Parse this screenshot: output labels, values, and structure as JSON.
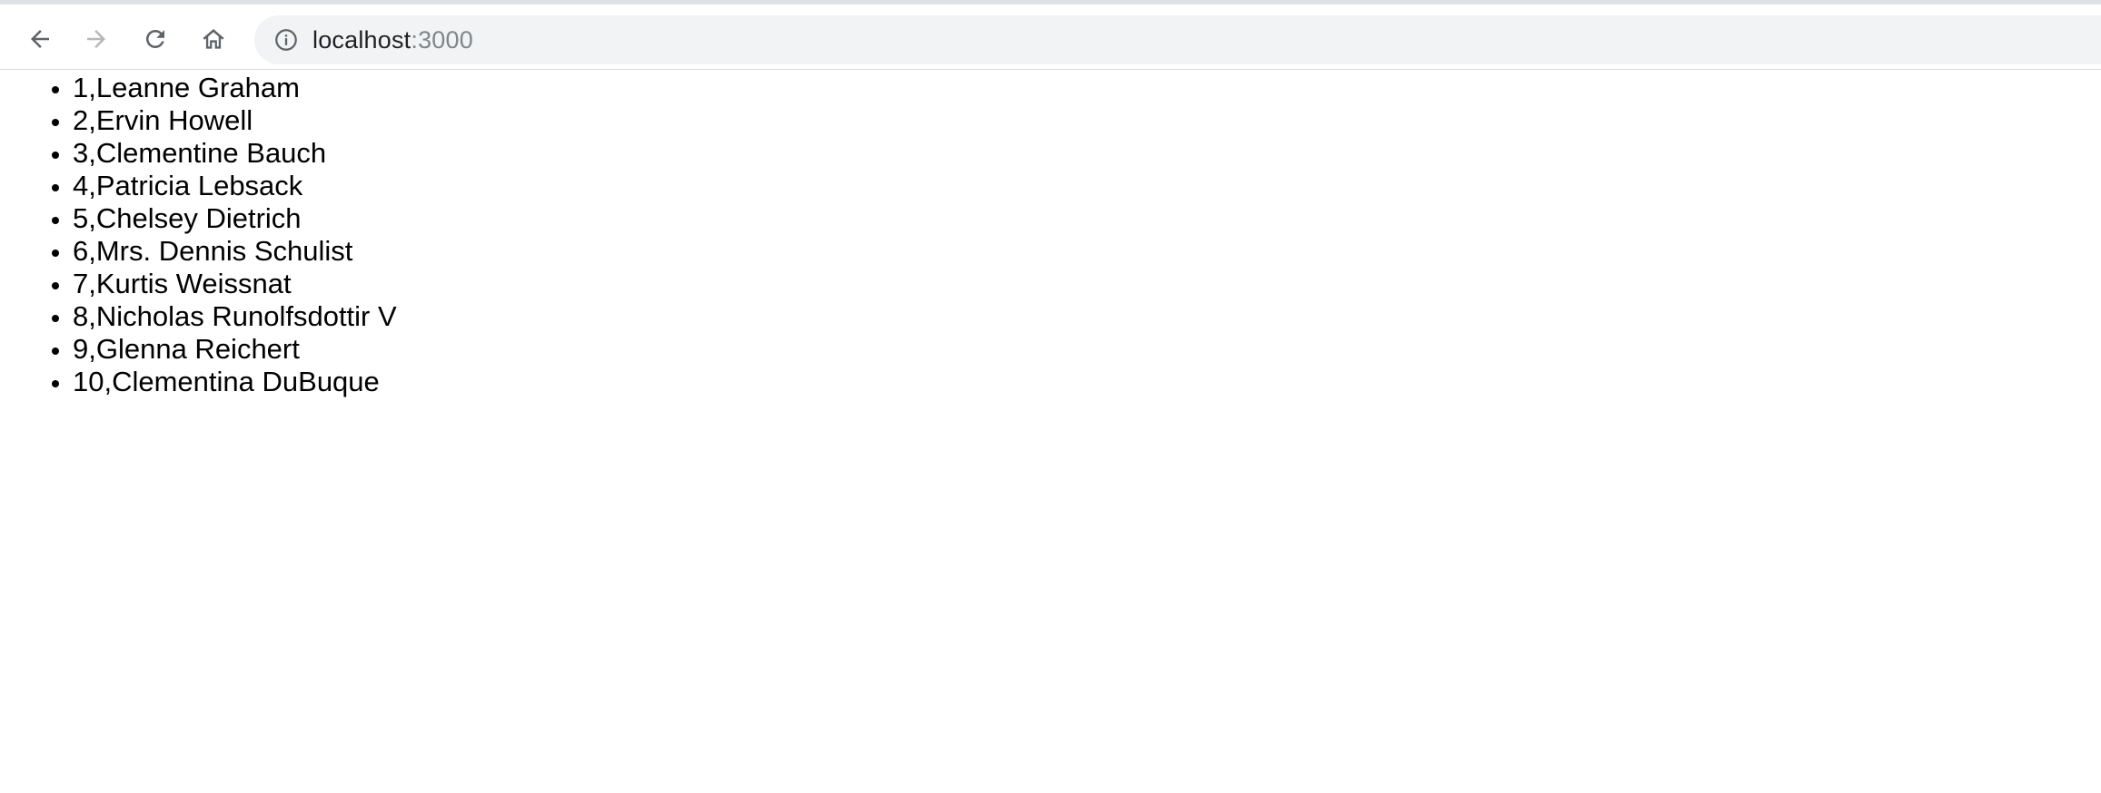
{
  "browser": {
    "url_host": "localhost",
    "url_port": ":3000",
    "icons": {
      "back": "arrow-left-icon",
      "forward": "arrow-right-icon",
      "reload": "reload-icon",
      "home": "home-icon",
      "site_info": "info-icon"
    },
    "colors": {
      "icon_active": "#5f6368",
      "icon_disabled": "#b5b7b9",
      "omnibox_bg": "#f1f3f4"
    }
  },
  "users": [
    {
      "label": "1,Leanne Graham"
    },
    {
      "label": "2,Ervin Howell"
    },
    {
      "label": "3,Clementine Bauch"
    },
    {
      "label": "4,Patricia Lebsack"
    },
    {
      "label": "5,Chelsey Dietrich"
    },
    {
      "label": "6,Mrs. Dennis Schulist"
    },
    {
      "label": "7,Kurtis Weissnat"
    },
    {
      "label": "8,Nicholas Runolfsdottir V"
    },
    {
      "label": "9,Glenna Reichert"
    },
    {
      "label": "10,Clementina DuBuque"
    }
  ]
}
